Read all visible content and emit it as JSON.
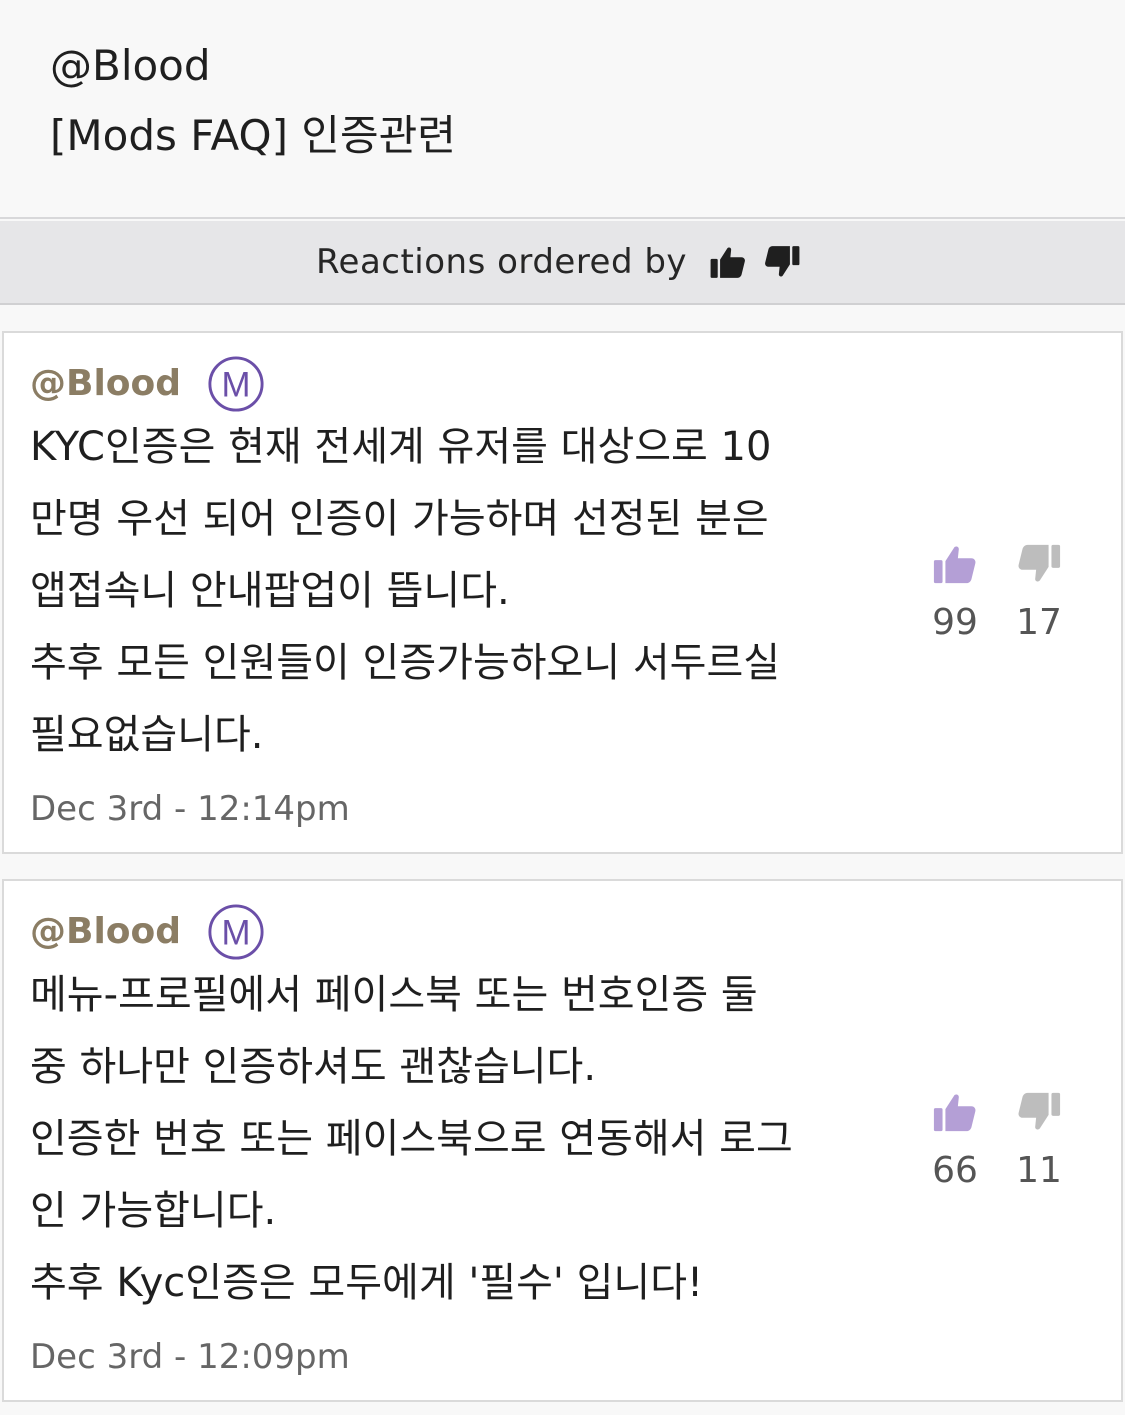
{
  "header": {
    "user": "@Blood",
    "title": "[Mods FAQ] 인증관련"
  },
  "sort_bar": {
    "label": "Reactions ordered by",
    "icons": [
      "thumbs-up-icon",
      "thumbs-down-icon"
    ]
  },
  "colors": {
    "author": "#8b7d64",
    "mod_badge": "#6b4fa8",
    "upvote": "#b49fd6",
    "downvote": "#bdbdbd"
  },
  "comments": [
    {
      "author": "@Blood",
      "badge": "M",
      "body": "KYC인증은 현재 전세계 유저를 대상으로 10\n만명 우선 되어 인증이 가능하며 선정된 분은\n앱접속니 안내팝업이 뜹니다.\n추후 모든 인원들이 인증가능하오니 서두르실\n필요없습니다.",
      "timestamp": "Dec 3rd - 12:14pm",
      "upvotes": "99",
      "downvotes": "17"
    },
    {
      "author": "@Blood",
      "badge": "M",
      "body": "메뉴-프로필에서 페이스북 또는 번호인증 둘\n중 하나만 인증하셔도 괜찮습니다.\n인증한 번호 또는 페이스북으로 연동해서 로그\n인 가능합니다.\n추후 Kyc인증은 모두에게 '필수' 입니다!",
      "timestamp": "Dec 3rd - 12:09pm",
      "upvotes": "66",
      "downvotes": "11"
    }
  ]
}
